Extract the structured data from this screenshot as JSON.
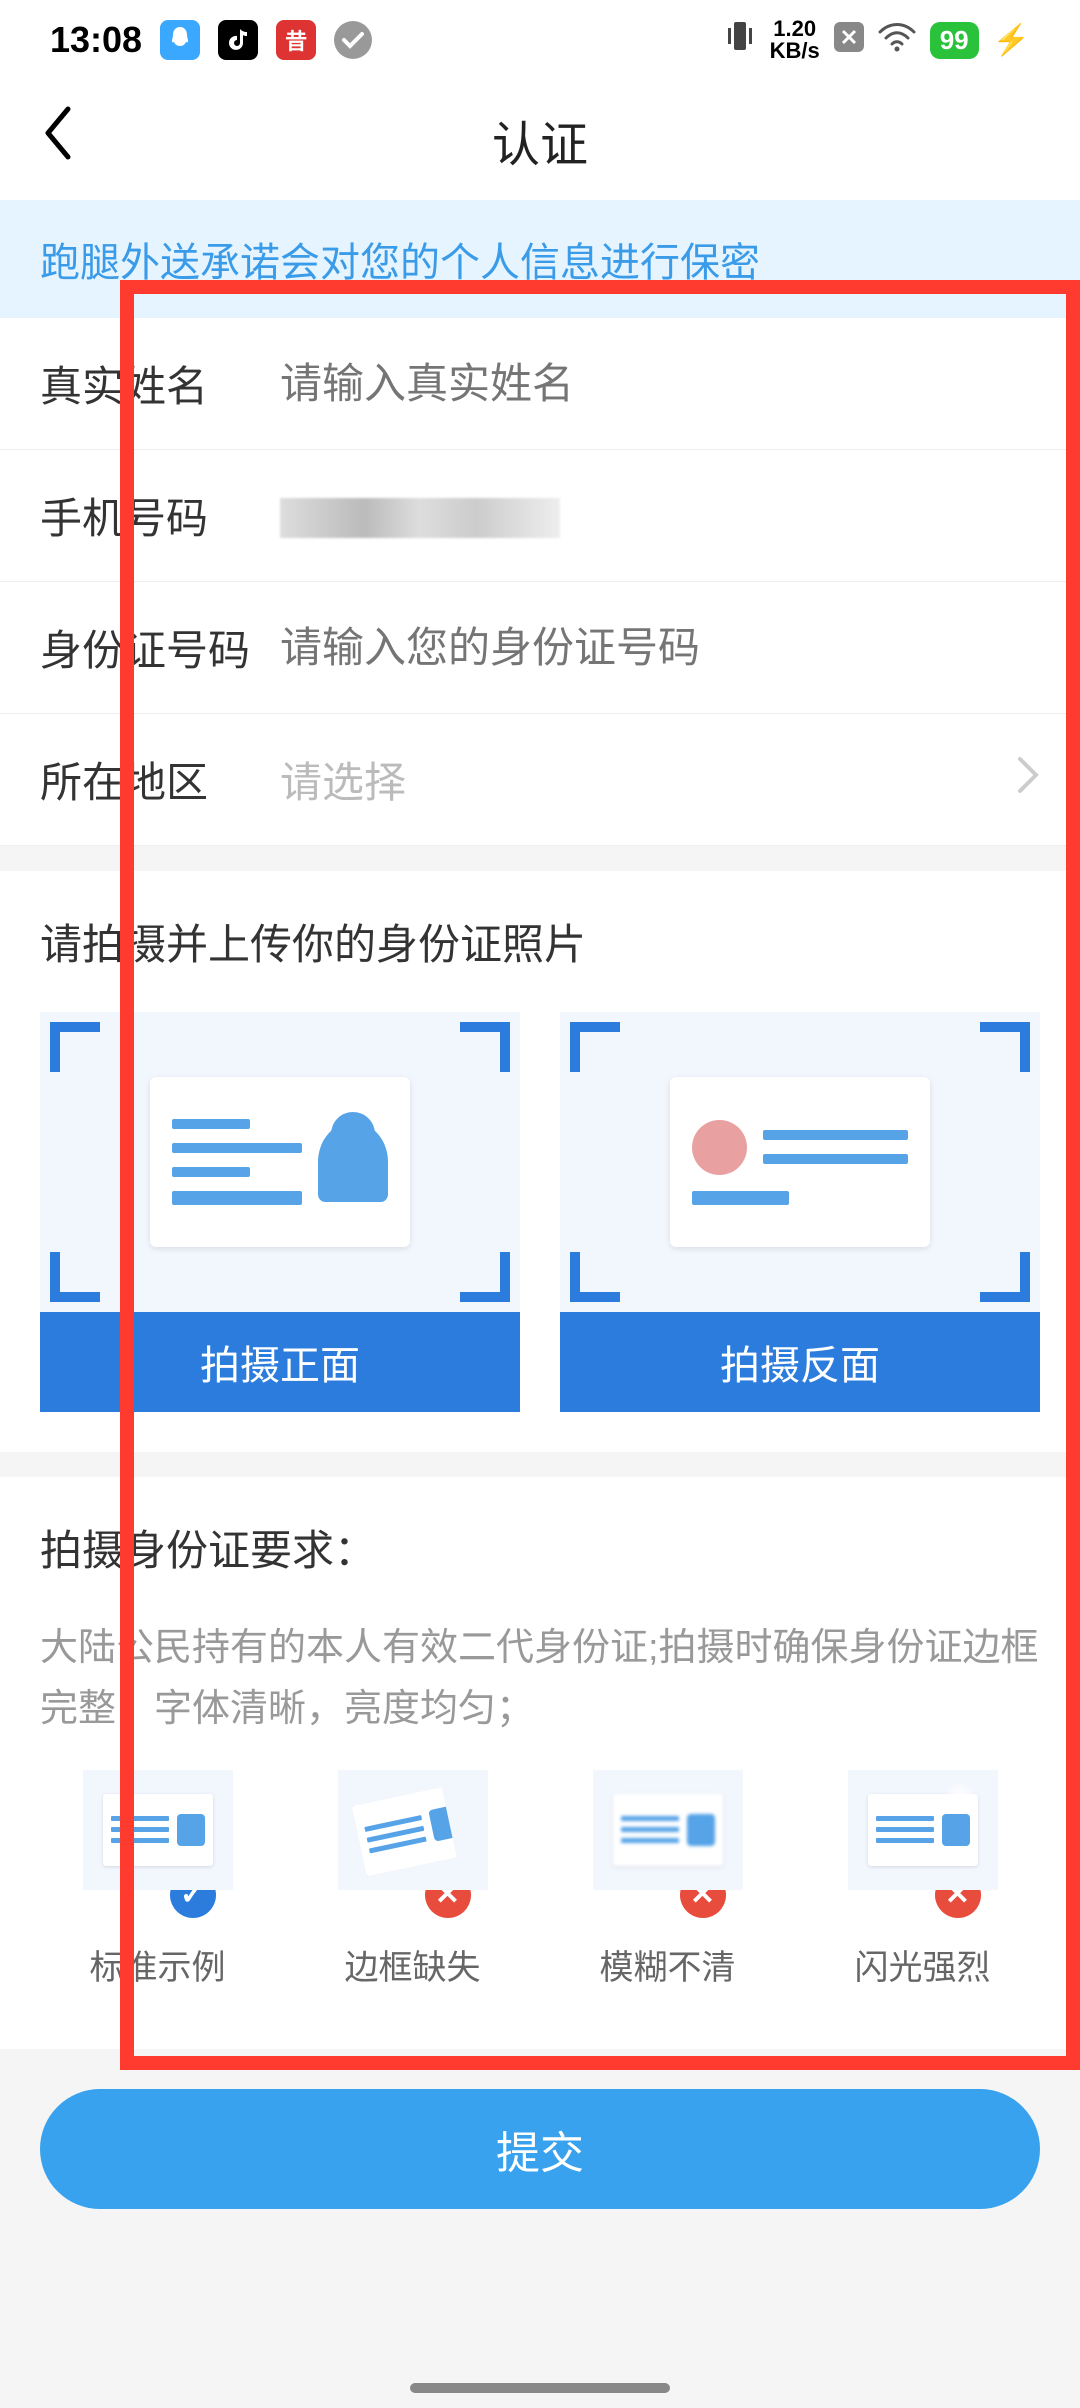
{
  "status_bar": {
    "time": "13:08",
    "speed_value": "1.20",
    "speed_unit": "KB/s",
    "battery": "99"
  },
  "header": {
    "title": "认证"
  },
  "banner": {
    "text": "跑腿外送承诺会对您的个人信息进行保密"
  },
  "form": {
    "name_label": "真实姓名",
    "name_placeholder": "请输入真实姓名",
    "phone_label": "手机号码",
    "phone_value_redacted": true,
    "idnum_label": "身份证号码",
    "idnum_placeholder": "请输入您的身份证号码",
    "region_label": "所在地区",
    "region_placeholder": "请选择"
  },
  "capture_section": {
    "title": "请拍摄并上传你的身份证照片",
    "front_btn": "拍摄正面",
    "back_btn": "拍摄反面"
  },
  "requirements": {
    "title": "拍摄身份证要求：",
    "desc": "大陆公民持有的本人有效二代身份证;拍摄时确保身份证边框完整，字体清晰，亮度均匀；",
    "examples": [
      {
        "label": "标准示例",
        "ok": true
      },
      {
        "label": "边框缺失",
        "ok": false
      },
      {
        "label": "模糊不清",
        "ok": false
      },
      {
        "label": "闪光强烈",
        "ok": false
      }
    ]
  },
  "submit": {
    "label": "提交"
  },
  "colors": {
    "accent": "#2b7cdd",
    "banner_bg": "#e6f4ff",
    "primary_btn": "#38a2ef",
    "error": "#e74c3c"
  }
}
